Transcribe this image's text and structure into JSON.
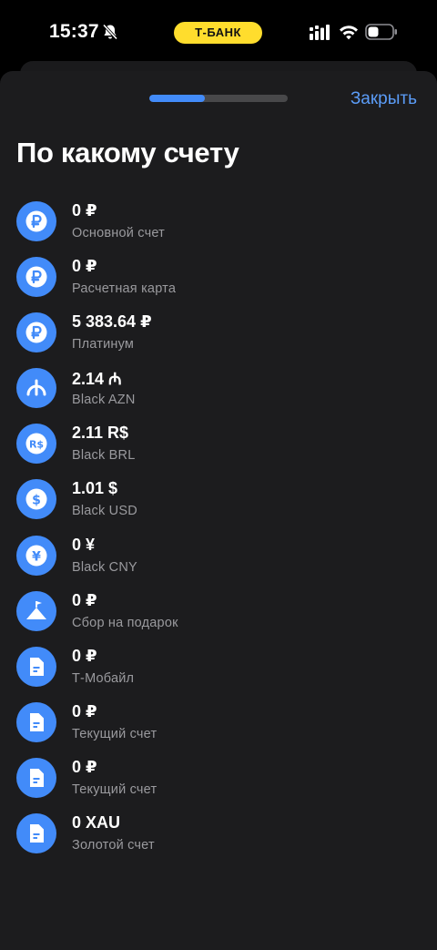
{
  "status_bar": {
    "time": "15:37",
    "bank_label": "Т-БАНК"
  },
  "header": {
    "progress": 0.4,
    "close_label": "Закрыть",
    "title": "По какому счету"
  },
  "colors": {
    "accent": "#428bf9",
    "link": "#5b9cf7",
    "pill": "#ffdd2d",
    "sheet": "#1c1c1e"
  },
  "accounts": [
    {
      "amount": "0 ₽",
      "name": "Основной счет",
      "icon": "ruble-icon"
    },
    {
      "amount": "0 ₽",
      "name": "Расчетная карта",
      "icon": "ruble-icon"
    },
    {
      "amount": "5 383.64 ₽",
      "name": "Платинум",
      "icon": "ruble-icon"
    },
    {
      "amount": "2.14 ₼",
      "name": "Black AZN",
      "icon": "manat-icon"
    },
    {
      "amount": "2.11 R$",
      "name": "Black BRL",
      "icon": "real-icon"
    },
    {
      "amount": "1.01 $",
      "name": "Black USD",
      "icon": "dollar-icon"
    },
    {
      "amount": "0 ¥",
      "name": "Black CNY",
      "icon": "yuan-icon"
    },
    {
      "amount": "0 ₽",
      "name": "Сбор на подарок",
      "icon": "mountain-flag-icon"
    },
    {
      "amount": "0 ₽",
      "name": "Т-Мобайл",
      "icon": "document-icon"
    },
    {
      "amount": "0 ₽",
      "name": "Текущий счет",
      "icon": "document-icon"
    },
    {
      "amount": "0 ₽",
      "name": "Текущий счет",
      "icon": "document-icon"
    },
    {
      "amount": "0 XAU",
      "name": "Золотой счет",
      "icon": "document-icon"
    }
  ]
}
